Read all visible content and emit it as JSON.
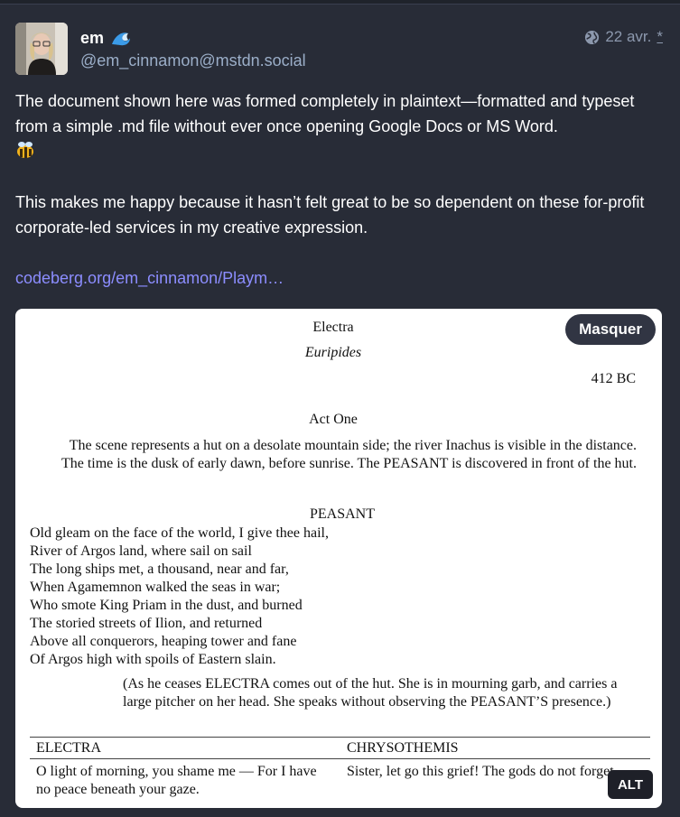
{
  "post": {
    "author": {
      "display_name": "em",
      "name_emoji": "wave-emoji",
      "handle": "@em_cinnamon@mstdn.social"
    },
    "visibility_icon": "globe-icon",
    "timestamp": "22 avr.",
    "edited_marker": "*",
    "paragraph_1": "The document shown here was formed completely in plaintext—formatted and typeset from a simple .md file without ever once opening Google Docs or MS Word.",
    "paragraph_1_emoji": "bee-emoji",
    "paragraph_2": "This makes me happy because it hasn’t felt great to be so dependent on these for-profit corporate-led services in my creative expression.",
    "link_text": "codeberg.org/em_cinnamon/Playm…"
  },
  "media": {
    "hide_button_label": "Masquer",
    "alt_badge_label": "ALT",
    "document": {
      "title": "Electra",
      "author": "Euripides",
      "date": "412 BC",
      "act": "Act One",
      "stage_direction": "The scene represents a hut on a desolate mountain side; the river Inachus is visible in the distance. The time is the dusk of early dawn, before sunrise. The PEASANT is discovered in front of the hut.",
      "speaker": "PEASANT",
      "verse": [
        "Old gleam on the face of the world, I give thee hail,",
        "River of Argos land, where sail on sail",
        "The long ships met, a thousand, near and far,",
        "When Agamemnon walked the seas in war;",
        "Who smote King Priam in the dust, and burned",
        "The storied streets of Ilion, and returned",
        "Above all conquerors, heaping tower and fane",
        "Of Argos high with spoils of Eastern slain."
      ],
      "direction": "(As he ceases ELECTRA comes out of the hut. She is in mourning garb, and carries a large pitcher on her head. She speaks without observing the PEASANT’S presence.)",
      "table": {
        "headers": [
          "ELECTRA",
          "CHRYSOTHEMIS"
        ],
        "row": [
          "O light of morning, you shame me — For I have no peace beneath your gaze.",
          "Sister, let go this grief! The gods do not forget"
        ]
      }
    }
  }
}
